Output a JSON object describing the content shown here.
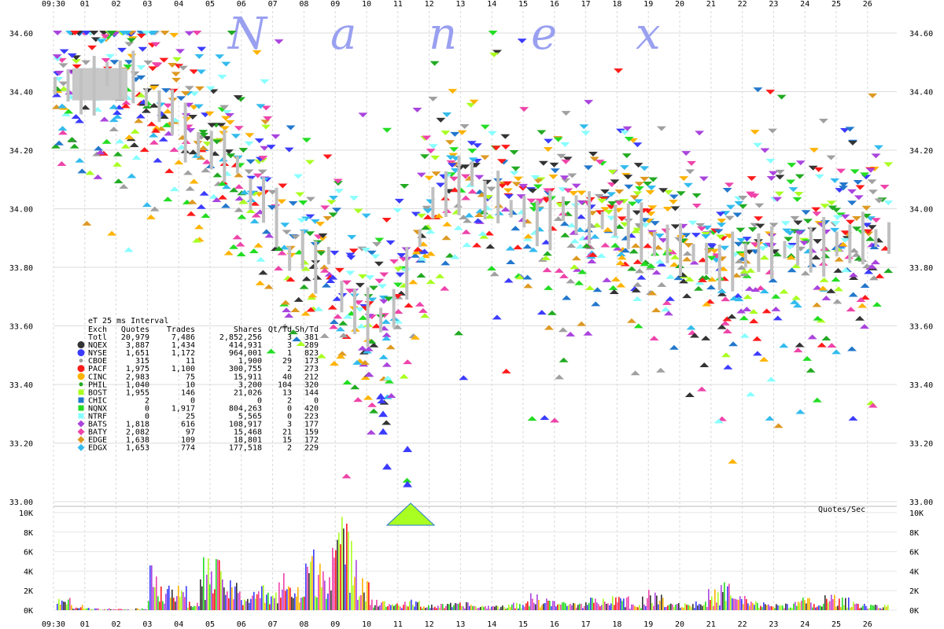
{
  "chart_data": {
    "type": "scatter",
    "watermark": [
      "N",
      "a",
      "n",
      "e",
      "x"
    ],
    "x_ticks": [
      "09:30",
      "01",
      "02",
      "03",
      "04",
      "05",
      "06",
      "07",
      "08",
      "09",
      "10",
      "11",
      "12",
      "13",
      "14",
      "15",
      "16",
      "17",
      "18",
      "19",
      "20",
      "21",
      "22",
      "23",
      "24",
      "25",
      "26"
    ],
    "y_ticks": [
      "34.60",
      "34.40",
      "34.20",
      "34.00",
      "33.80",
      "33.60",
      "33.40",
      "33.20",
      "33.00"
    ],
    "ylim": [
      33.0,
      34.6
    ],
    "volume_title": "Quotes/Sec",
    "volume_ticks": [
      "10K",
      "8K",
      "6K",
      "4K",
      "2K",
      "0K"
    ],
    "volume_ylim": [
      0,
      10000
    ],
    "legend": {
      "interval": "eT 25 ms Interval",
      "headers": [
        "Exch",
        "Quotes",
        "Trades",
        "Shares",
        "Qt/Td",
        "Sh/Td"
      ],
      "rows": [
        {
          "exch": "Totl",
          "quotes": "20,979",
          "trades": "7,486",
          "shares": "2,852,256",
          "qt_td": "3",
          "sh_td": "381",
          "color": "",
          "marker": "none"
        },
        {
          "exch": "NQEX",
          "quotes": "3,887",
          "trades": "1,434",
          "shares": "414,931",
          "qt_td": "3",
          "sh_td": "289",
          "color": "#333333",
          "marker": "circle"
        },
        {
          "exch": "NYSE",
          "quotes": "1,651",
          "trades": "1,172",
          "shares": "964,001",
          "qt_td": "1",
          "sh_td": "823",
          "color": "#3b3bff",
          "marker": "circle"
        },
        {
          "exch": "CBOE",
          "quotes": "315",
          "trades": "11",
          "shares": "1,900",
          "qt_td": "29",
          "sh_td": "173",
          "color": "#a0a0a0",
          "marker": "dot"
        },
        {
          "exch": "PACF",
          "quotes": "1,975",
          "trades": "1,100",
          "shares": "300,755",
          "qt_td": "2",
          "sh_td": "273",
          "color": "#ff1a1a",
          "marker": "circle"
        },
        {
          "exch": "CINC",
          "quotes": "2,983",
          "trades": "75",
          "shares": "15,911",
          "qt_td": "40",
          "sh_td": "212",
          "color": "#ffb300",
          "marker": "circle"
        },
        {
          "exch": "PHIL",
          "quotes": "1,040",
          "trades": "10",
          "shares": "3,200",
          "qt_td": "104",
          "sh_td": "320",
          "color": "#22aa22",
          "marker": "dot"
        },
        {
          "exch": "BOST",
          "quotes": "1,955",
          "trades": "146",
          "shares": "21,026",
          "qt_td": "13",
          "sh_td": "144",
          "color": "#aaff22",
          "marker": "square"
        },
        {
          "exch": "CHIC",
          "quotes": "2",
          "trades": "0",
          "shares": "0",
          "qt_td": "2",
          "sh_td": "0",
          "color": "#2277cc",
          "marker": "square"
        },
        {
          "exch": "NQNX",
          "quotes": "0",
          "trades": "1,917",
          "shares": "804,263",
          "qt_td": "0",
          "sh_td": "420",
          "color": "#22dd22",
          "marker": "square"
        },
        {
          "exch": "NTRF",
          "quotes": "0",
          "trades": "25",
          "shares": "5,565",
          "qt_td": "0",
          "sh_td": "223",
          "color": "#88ffff",
          "marker": "square"
        },
        {
          "exch": "BATS",
          "quotes": "1,818",
          "trades": "616",
          "shares": "108,917",
          "qt_td": "3",
          "sh_td": "177",
          "color": "#aa44dd",
          "marker": "diamond"
        },
        {
          "exch": "BATY",
          "quotes": "2,082",
          "trades": "97",
          "shares": "15,468",
          "qt_td": "21",
          "sh_td": "159",
          "color": "#ee44aa",
          "marker": "diamond"
        },
        {
          "exch": "EDGE",
          "quotes": "1,638",
          "trades": "109",
          "shares": "18,801",
          "qt_td": "15",
          "sh_td": "172",
          "color": "#dd9922",
          "marker": "diamond"
        },
        {
          "exch": "EDGX",
          "quotes": "1,653",
          "trades": "774",
          "shares": "177,518",
          "qt_td": "2",
          "sh_td": "229",
          "color": "#33bbee",
          "marker": "diamond"
        }
      ]
    },
    "trade_band": [
      34.42,
      34.42,
      34.4,
      34.42,
      34.46,
      34.44,
      34.45,
      34.38,
      34.35,
      34.33,
      34.26,
      34.22,
      34.2,
      34.18,
      34.15,
      34.05,
      34.03,
      33.97,
      33.83,
      33.86,
      33.8,
      33.84,
      33.7,
      33.65,
      33.63,
      33.62,
      33.66,
      33.78,
      33.9,
      34.02,
      34.05,
      34.08,
      34.12,
      34.03,
      34.04,
      34.0,
      33.99,
      33.95,
      33.96,
      34.0,
      33.98,
      33.97,
      33.96,
      33.96,
      33.94,
      33.92,
      33.88,
      33.88,
      33.86,
      33.85,
      33.83,
      33.8,
      33.82,
      33.84,
      33.85,
      33.85,
      33.86,
      33.86,
      33.86,
      33.87,
      33.88,
      33.88,
      33.9,
      33.9,
      33.9
    ],
    "volume_profile": [
      1200,
      500,
      300,
      200,
      150,
      100,
      200,
      4200,
      3000,
      2400,
      800,
      5200,
      4800,
      2800,
      1900,
      2500,
      1800,
      4100,
      2200,
      6000,
      5500,
      9100,
      8300,
      4300,
      1200,
      900,
      800,
      1000,
      600,
      600,
      700,
      800,
      500,
      500,
      600,
      700,
      1600,
      1300,
      900,
      800,
      900,
      1200,
      2400,
      1500,
      700,
      1900,
      1500,
      900,
      800,
      900,
      2000,
      2800,
      1500,
      900,
      800,
      600,
      900,
      1200,
      700,
      1600,
      1200,
      900,
      700,
      500,
      400
    ]
  }
}
